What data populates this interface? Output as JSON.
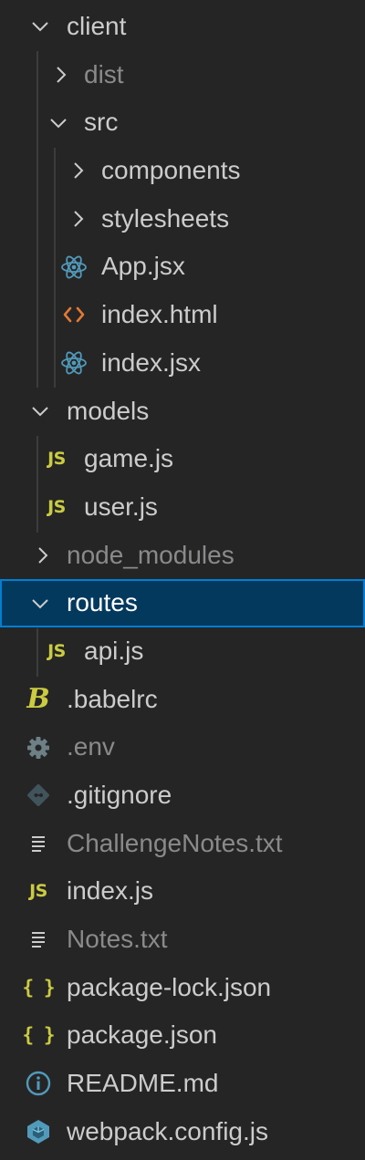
{
  "explorer": {
    "items": [
      {
        "label": "client",
        "icon": "chevron-down-icon",
        "expanded": true
      },
      {
        "label": "dist",
        "icon": "chevron-right-icon",
        "expanded": false
      },
      {
        "label": "src",
        "icon": "chevron-down-icon",
        "expanded": true
      },
      {
        "label": "components",
        "icon": "chevron-right-icon",
        "expanded": false
      },
      {
        "label": "stylesheets",
        "icon": "chevron-right-icon",
        "expanded": false
      },
      {
        "label": "App.jsx",
        "icon": "react-icon"
      },
      {
        "label": "index.html",
        "icon": "html-icon"
      },
      {
        "label": "index.jsx",
        "icon": "react-icon"
      },
      {
        "label": "models",
        "icon": "chevron-down-icon",
        "expanded": true
      },
      {
        "label": "game.js",
        "icon": "javascript-icon"
      },
      {
        "label": "user.js",
        "icon": "javascript-icon"
      },
      {
        "label": "node_modules",
        "icon": "chevron-right-icon",
        "expanded": false
      },
      {
        "label": "routes",
        "icon": "chevron-down-icon",
        "expanded": true,
        "selected": true
      },
      {
        "label": "api.js",
        "icon": "javascript-icon"
      },
      {
        "label": ".babelrc",
        "icon": "babel-icon"
      },
      {
        "label": ".env",
        "icon": "gear-icon"
      },
      {
        "label": ".gitignore",
        "icon": "git-icon"
      },
      {
        "label": "ChallengeNotes.txt",
        "icon": "text-file-icon"
      },
      {
        "label": "index.js",
        "icon": "javascript-icon"
      },
      {
        "label": "Notes.txt",
        "icon": "text-file-icon"
      },
      {
        "label": "package-lock.json",
        "icon": "json-icon"
      },
      {
        "label": "package.json",
        "icon": "json-icon"
      },
      {
        "label": "README.md",
        "icon": "info-icon"
      },
      {
        "label": "webpack.config.js",
        "icon": "webpack-icon"
      }
    ],
    "icon_glyphs": {
      "javascript": "JS",
      "json": "{ }",
      "babel": "B"
    }
  },
  "colors": {
    "background": "#252526",
    "text": "#cccccc",
    "dimmed_text": "#8a8a8a",
    "selection_bg": "#04395e",
    "selection_border": "#007fd4",
    "react": "#519aba",
    "html": "#e37933",
    "javascript": "#cbcb41",
    "info": "#519aba",
    "webpack": "#519aba"
  }
}
